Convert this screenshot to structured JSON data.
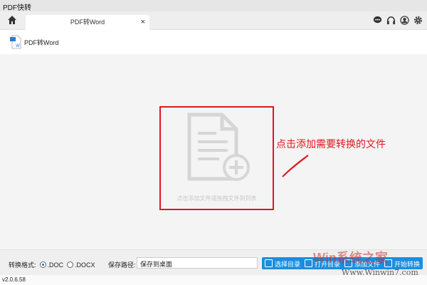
{
  "app": {
    "title": "PDF快转",
    "version": "v2.0.6.58"
  },
  "tabs": [
    {
      "label": "PDF转Word",
      "close": "×"
    }
  ],
  "toolbar_icons": [
    "chat-icon",
    "headset-icon",
    "user-icon",
    "gear-icon"
  ],
  "subheader": {
    "label": "PDF转Word"
  },
  "dropzone": {
    "hint": "点击添加文件或拖拽文件到列表"
  },
  "callout": "点击添加需要转换的文件",
  "bottom": {
    "format_label": "转换格式:",
    "opt_doc": ".DOC",
    "opt_docx": ".DOCX",
    "path_label": "保存路径:",
    "path_value": "保存到桌面",
    "buttons": [
      "选择目录",
      "打开目录",
      "添加文件",
      "开始转换"
    ]
  },
  "watermark": {
    "brand": "Win系统之家",
    "url": "Www.Winwin7.com"
  },
  "colors": {
    "accent": "#1a8ee0",
    "highlight": "#e0161d"
  }
}
